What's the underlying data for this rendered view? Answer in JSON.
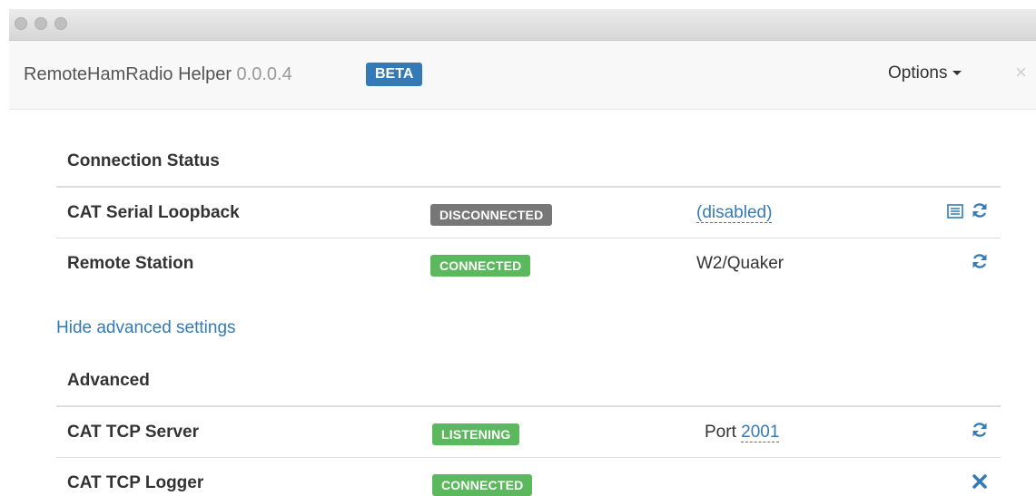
{
  "window": {
    "app_name": "RemoteHamRadio Helper",
    "version": "0.0.0.4",
    "badge": "BETA",
    "options_label": "Options",
    "close_glyph": "×"
  },
  "connection_status": {
    "heading": "Connection Status",
    "rows": [
      {
        "label": "CAT Serial Loopback",
        "status": "DISCONNECTED",
        "status_color": "#777777",
        "detail": "(disabled)",
        "icons": [
          "list-icon",
          "refresh-icon"
        ]
      },
      {
        "label": "Remote Station",
        "status": "CONNECTED",
        "status_color": "#5cb85c",
        "detail": "W2/Quaker",
        "icons": [
          "refresh-icon"
        ]
      }
    ]
  },
  "advanced_toggle": "Hide advanced settings",
  "advanced": {
    "heading": "Advanced",
    "rows": [
      {
        "label": "CAT TCP Server",
        "status": "LISTENING",
        "status_color": "#5cb85c",
        "detail_prefix": "Port",
        "detail_value": "2001",
        "icons": [
          "refresh-icon"
        ]
      },
      {
        "label": "CAT TCP Logger",
        "status": "CONNECTED",
        "status_color": "#5cb85c",
        "icons": [
          "close-icon"
        ]
      }
    ]
  },
  "colors": {
    "link": "#337ab7",
    "primary": "#337ab7",
    "success": "#5cb85c",
    "default": "#777777"
  }
}
